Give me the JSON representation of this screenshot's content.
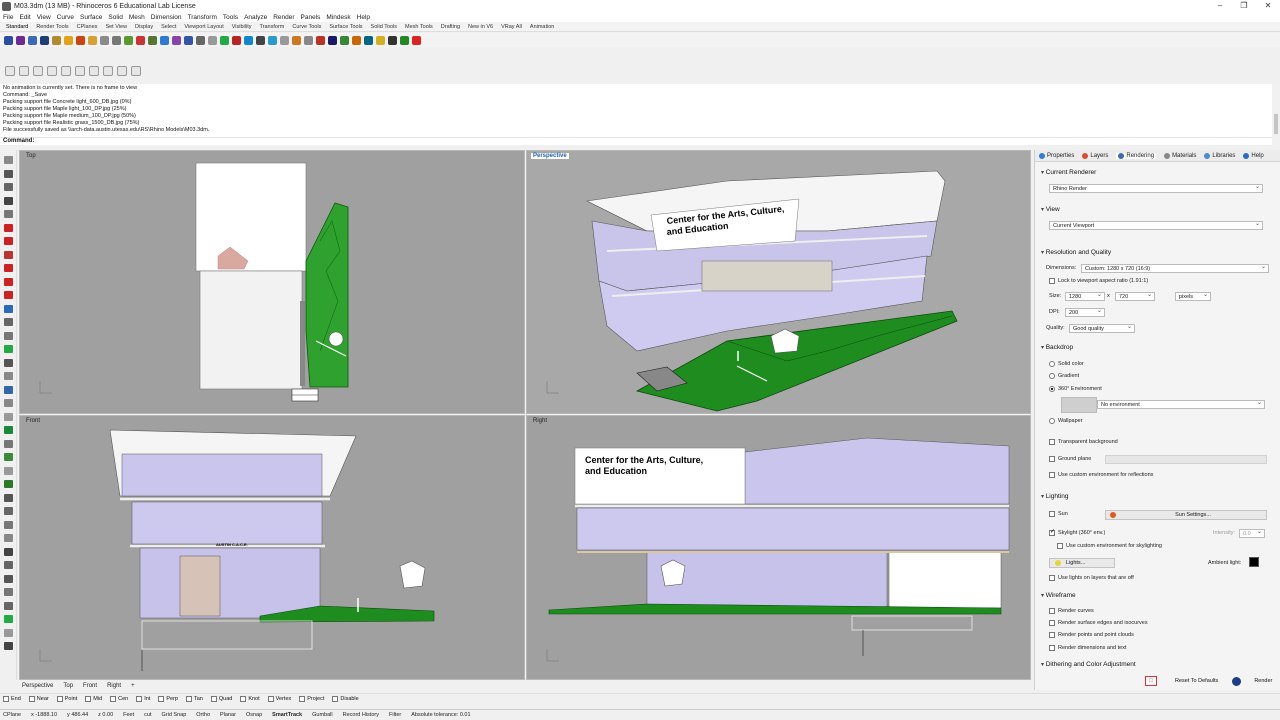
{
  "titlebar": {
    "title": "M03.3dm (13 MB) - Rhinoceros 6 Educational Lab License"
  },
  "menu": [
    "File",
    "Edit",
    "View",
    "Curve",
    "Surface",
    "Solid",
    "Mesh",
    "Dimension",
    "Transform",
    "Tools",
    "Analyze",
    "Render",
    "Panels",
    "Mindesk",
    "Help"
  ],
  "toolbar_tabs": [
    "Standard",
    "Render Tools",
    "CPlanes",
    "Set View",
    "Display",
    "Select",
    "Viewport Layout",
    "Visibility",
    "Transform",
    "Curve Tools",
    "Surface Tools",
    "Solid Tools",
    "Mesh Tools",
    "Drafting",
    "New in V6",
    "VRay All",
    "Animation"
  ],
  "toolbar_icon_colors": [
    "#2a4fa0",
    "#6f2a93",
    "#3a6ab8",
    "#1e3e7a",
    "#b08a2c",
    "#e2a21a",
    "#cc4411",
    "#d8a032",
    "#8a8a8a",
    "#777777",
    "#5a9a2a",
    "#cc3333",
    "#557733",
    "#2b7bd6",
    "#8844aa",
    "#3355aa",
    "#666666",
    "#999999",
    "#22aa44",
    "#bb2222",
    "#0d88cc",
    "#444444",
    "#2a9acc",
    "#999999",
    "#cc7722",
    "#888888",
    "#bb3322",
    "#1a1a6a",
    "#338833",
    "#cc6600",
    "#006688",
    "#d4b020",
    "#333333",
    "#228822",
    "#dd2222"
  ],
  "command": {
    "history": [
      "No animation is currently set. There is no frame to view",
      "Command: _Save",
      "Packing support file Concrete light_600_DB.jpg (0%)",
      "Packing support file Maple light_100_DP.jpg (25%)",
      "Packing support file Maple medium_100_DP.jpg (50%)",
      "Packing support file Realistic grass_1500_DB.jpg (75%)",
      "File successfully saved as \\\\arch-data.austin.utexas.edu\\RS\\Rhino Models\\M03.3dm."
    ],
    "prompt": "Command:"
  },
  "viewports": {
    "top": {
      "label": "Top"
    },
    "perspective": {
      "label": "Perspective"
    },
    "front": {
      "label": "Front"
    },
    "right": {
      "label": "Right"
    }
  },
  "building_sign": {
    "line1": "Center for the Arts, Culture,",
    "line2": "and Education"
  },
  "front_sign": "AUSTIN C.A.C.E.",
  "viewport_tabs": [
    "Perspective",
    "Top",
    "Front",
    "Right",
    "+"
  ],
  "osnaps": [
    "End",
    "Near",
    "Point",
    "Mid",
    "Cen",
    "Int",
    "Perp",
    "Tan",
    "Quad",
    "Knot",
    "Vertex",
    "Project",
    "Disable"
  ],
  "status": {
    "cplane": "CPlane",
    "x": "x -1888.10",
    "y": "y 486.44",
    "z": "z 0.00",
    "units": "Feet",
    "layer": "cut",
    "items": [
      "Grid Snap",
      "Ortho",
      "Planar",
      "Osnap",
      "SmartTrack",
      "Gumball",
      "Record History",
      "Filter",
      "Absolute tolerance: 0.01"
    ]
  },
  "panel": {
    "tabs": [
      "Properties",
      "Layers",
      "Rendering",
      "Materials",
      "Libraries",
      "Help"
    ],
    "current_renderer_title": "Current Renderer",
    "renderer": "Rhino Render",
    "view_title": "View",
    "view_value": "Current Viewport",
    "resolution_title": "Resolution and Quality",
    "dimensions_label": "Dimensions:",
    "dimensions_value": "Custom: 1280 x 720 (16:9)",
    "lock_label": "Lock to viewport aspect ratio (1.91:1)",
    "size_label": "Size:",
    "size_w": "1280",
    "size_h": "720",
    "size_units": "pixels",
    "dpi_label": "DPI:",
    "dpi_value": "200",
    "quality_label": "Quality:",
    "quality_value": "Good quality",
    "backdrop_title": "Backdrop",
    "solid_color": "Solid color",
    "gradient": "Gradient",
    "env360": "360° Environment",
    "no_env": "No environment",
    "wallpaper": "Wallpaper",
    "transparent_bg": "Transparent background",
    "ground_plane": "Ground plane",
    "custom_env_refl": "Use custom environment for reflections",
    "lighting_title": "Lighting",
    "sun": "Sun",
    "sun_settings": "Sun Settings...",
    "skylight": "Skylight (360° env.)",
    "intensity_label": "Intensity:",
    "intensity_value": "0.0",
    "custom_env_sky": "Use custom environment for skylighting",
    "lights_btn": "Lights...",
    "ambient_label": "Ambient light:",
    "use_lights_layers": "Use lights on layers that are off",
    "wireframe_title": "Wireframe",
    "render_curves": "Render curves",
    "render_edges": "Render surface edges and isocurves",
    "render_points": "Render points and point clouds",
    "render_dims": "Render dimensions and text",
    "dithering_title": "Dithering and Color Adjustment",
    "reset_btn": "Reset To Defaults",
    "render_btn": "Render"
  }
}
